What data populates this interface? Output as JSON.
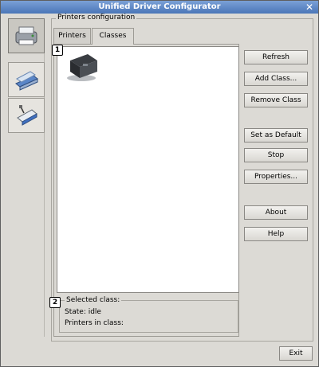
{
  "window": {
    "title": "Unified Driver Configurator"
  },
  "sidebar": {
    "items": [
      {
        "icon": "printer-icon",
        "active": true
      },
      {
        "icon": "scanner-icon",
        "active": false
      },
      {
        "icon": "port-icon",
        "active": false
      }
    ]
  },
  "main": {
    "group_title": "Printers configuration",
    "tabs": [
      {
        "label": "Printers",
        "active": false
      },
      {
        "label": "Classes",
        "active": true
      }
    ],
    "list": {
      "items": [
        {
          "icon": "printer-class-icon",
          "label": ""
        }
      ]
    },
    "callouts": [
      "1",
      "2"
    ],
    "selected": {
      "group_title": "Selected class:",
      "state_label": "State: idle",
      "printers_label": "Printers in class:"
    }
  },
  "buttons": {
    "refresh": "Refresh",
    "add_class": "Add Class...",
    "remove_class": "Remove Class",
    "set_default": "Set as Default",
    "stop": "Stop",
    "properties": "Properties...",
    "about": "About",
    "help": "Help",
    "exit": "Exit"
  }
}
